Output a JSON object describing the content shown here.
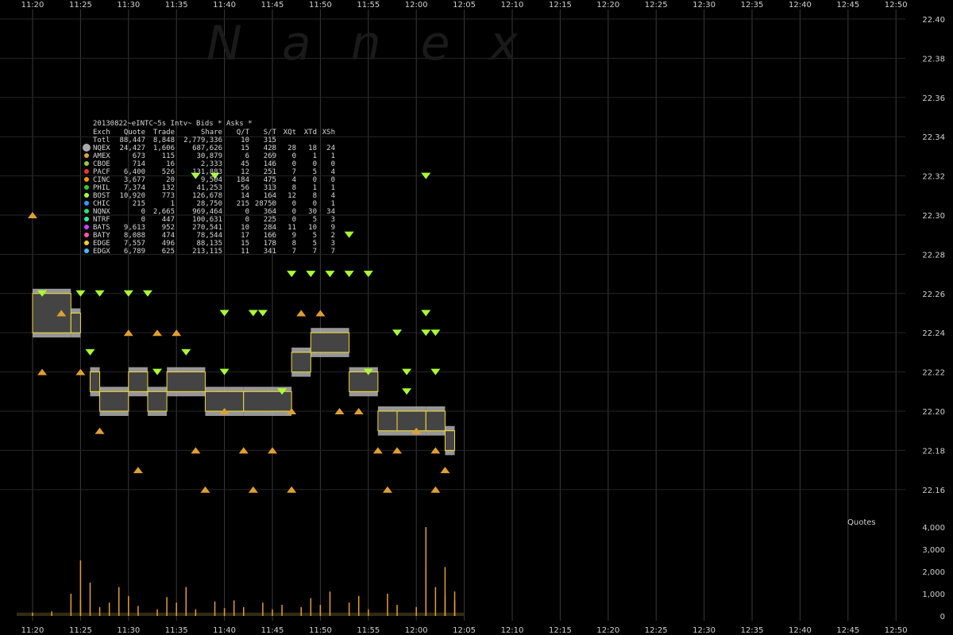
{
  "chart_data": {
    "type": "scatter",
    "watermark": "Nanex",
    "title": "20130822~eINTC~5s Intv~ Bids * Asks *",
    "x_ticks": [
      "11:20",
      "11:25",
      "11:30",
      "11:35",
      "11:40",
      "11:45",
      "11:50",
      "11:55",
      "12:00",
      "12:05",
      "12:10",
      "12:15",
      "12:20",
      "12:25",
      "12:30",
      "12:35",
      "12:40",
      "12:45",
      "12:50"
    ],
    "y_ticks": [
      "22.40",
      "22.38",
      "22.36",
      "22.34",
      "22.32",
      "22.30",
      "22.28",
      "22.26",
      "22.24",
      "22.22",
      "22.20",
      "22.18",
      "22.16"
    ],
    "y_range": [
      22.15,
      22.41
    ],
    "volume_label": "Quotes",
    "volume_ticks": [
      "4,000",
      "3,000",
      "2,000",
      "1,000",
      "0"
    ],
    "volume_range": [
      0,
      4000
    ],
    "legend_header": [
      "Exch",
      "Quote",
      "Trade",
      "Share",
      "Q/T",
      "S/T",
      "XQt",
      "XTd",
      "XSh"
    ],
    "legend_total": [
      "Totl",
      "88,447",
      "8,848",
      "2,779,336",
      "10",
      "315",
      "",
      "",
      ""
    ],
    "legend_rows": [
      {
        "color": "#aaaaaa",
        "cells": [
          "NQEX",
          "24,427",
          "1,606",
          "687,626",
          "15",
          "428",
          "28",
          "18",
          "24"
        ]
      },
      {
        "color": "#e0a030",
        "cells": [
          "AMEX",
          "673",
          "115",
          "30,879",
          "6",
          "269",
          "0",
          "1",
          "1"
        ]
      },
      {
        "color": "#99cc33",
        "cells": [
          "CBOE",
          "714",
          "16",
          "2,333",
          "45",
          "146",
          "0",
          "0",
          "0"
        ]
      },
      {
        "color": "#ff3333",
        "cells": [
          "PACF",
          "6,400",
          "526",
          "131,883",
          "12",
          "251",
          "7",
          "5",
          "4"
        ]
      },
      {
        "color": "#ff9900",
        "cells": [
          "CINC",
          "3,677",
          "20",
          "9,504",
          "184",
          "475",
          "4",
          "0",
          "0"
        ]
      },
      {
        "color": "#33cc33",
        "cells": [
          "PHIL",
          "7,374",
          "132",
          "41,253",
          "56",
          "313",
          "8",
          "1",
          "1"
        ]
      },
      {
        "color": "#aaff33",
        "cells": [
          "BOST",
          "10,920",
          "773",
          "126,678",
          "14",
          "164",
          "12",
          "8",
          "4"
        ]
      },
      {
        "color": "#3399ff",
        "cells": [
          "CHIC",
          "215",
          "1",
          "28,750",
          "215",
          "28750",
          "0",
          "0",
          "1"
        ]
      },
      {
        "color": "#33dd66",
        "cells": [
          "NQNX",
          "0",
          "2,665",
          "969,464",
          "0",
          "364",
          "0",
          "30",
          "34"
        ]
      },
      {
        "color": "#33ee99",
        "cells": [
          "NTRF",
          "0",
          "447",
          "100,631",
          "0",
          "225",
          "0",
          "5",
          "3"
        ]
      },
      {
        "color": "#cc44ff",
        "cells": [
          "BATS",
          "9,613",
          "952",
          "270,541",
          "10",
          "284",
          "11",
          "10",
          "9"
        ]
      },
      {
        "color": "#ff55aa",
        "cells": [
          "BATY",
          "8,088",
          "474",
          "78,544",
          "17",
          "166",
          "9",
          "5",
          "2"
        ]
      },
      {
        "color": "#ffcc33",
        "cells": [
          "EDGE",
          "7,557",
          "496",
          "88,135",
          "15",
          "178",
          "8",
          "5",
          "3"
        ]
      },
      {
        "color": "#44bbff",
        "cells": [
          "EDGX",
          "6,789",
          "625",
          "213,115",
          "11",
          "341",
          "7",
          "7",
          "7"
        ]
      }
    ],
    "nbbo_boxes": [
      {
        "t0": "11:20",
        "t1": "11:24",
        "bid": 22.24,
        "ask": 22.26
      },
      {
        "t0": "11:24",
        "t1": "11:25",
        "bid": 22.24,
        "ask": 22.25
      },
      {
        "t0": "11:26",
        "t1": "11:27",
        "bid": 22.21,
        "ask": 22.22
      },
      {
        "t0": "11:27",
        "t1": "11:30",
        "bid": 22.2,
        "ask": 22.21
      },
      {
        "t0": "11:30",
        "t1": "11:32",
        "bid": 22.21,
        "ask": 22.22
      },
      {
        "t0": "11:32",
        "t1": "11:34",
        "bid": 22.2,
        "ask": 22.21
      },
      {
        "t0": "11:34",
        "t1": "11:38",
        "bid": 22.21,
        "ask": 22.22
      },
      {
        "t0": "11:38",
        "t1": "11:42",
        "bid": 22.2,
        "ask": 22.21
      },
      {
        "t0": "11:42",
        "t1": "11:47",
        "bid": 22.2,
        "ask": 22.21
      },
      {
        "t0": "11:47",
        "t1": "11:49",
        "bid": 22.22,
        "ask": 22.23
      },
      {
        "t0": "11:49",
        "t1": "11:53",
        "bid": 22.23,
        "ask": 22.24
      },
      {
        "t0": "11:53",
        "t1": "11:56",
        "bid": 22.21,
        "ask": 22.22
      },
      {
        "t0": "11:56",
        "t1": "11:58",
        "bid": 22.19,
        "ask": 22.2
      },
      {
        "t0": "11:58",
        "t1": "12:01",
        "bid": 22.19,
        "ask": 22.2
      },
      {
        "t0": "12:01",
        "t1": "12:03",
        "bid": 22.19,
        "ask": 22.2
      },
      {
        "t0": "12:03",
        "t1": "12:04",
        "bid": 22.18,
        "ask": 22.19
      }
    ],
    "bid_quotes": [
      {
        "t": "11:20",
        "p": 22.3
      },
      {
        "t": "11:23",
        "p": 22.25
      },
      {
        "t": "11:25",
        "p": 22.22
      },
      {
        "t": "11:27",
        "p": 22.19
      },
      {
        "t": "11:30",
        "p": 22.24
      },
      {
        "t": "11:31",
        "p": 22.17
      },
      {
        "t": "11:33",
        "p": 22.24
      },
      {
        "t": "11:35",
        "p": 22.24
      },
      {
        "t": "11:37",
        "p": 22.18
      },
      {
        "t": "11:40",
        "p": 22.2
      },
      {
        "t": "11:42",
        "p": 22.18
      },
      {
        "t": "11:45",
        "p": 22.18
      },
      {
        "t": "11:47",
        "p": 22.2
      },
      {
        "t": "11:48",
        "p": 22.25
      },
      {
        "t": "11:50",
        "p": 22.25
      },
      {
        "t": "11:52",
        "p": 22.2
      },
      {
        "t": "11:54",
        "p": 22.2
      },
      {
        "t": "11:56",
        "p": 22.18
      },
      {
        "t": "11:58",
        "p": 22.18
      },
      {
        "t": "12:00",
        "p": 22.19
      },
      {
        "t": "12:02",
        "p": 22.18
      },
      {
        "t": "12:03",
        "p": 22.17
      },
      {
        "t": "11:21",
        "p": 22.22
      },
      {
        "t": "11:38",
        "p": 22.16
      },
      {
        "t": "11:43",
        "p": 22.16
      },
      {
        "t": "11:47",
        "p": 22.16
      },
      {
        "t": "11:57",
        "p": 22.16
      },
      {
        "t": "12:02",
        "p": 22.16
      }
    ],
    "ask_quotes": [
      {
        "t": "11:21",
        "p": 22.26
      },
      {
        "t": "11:25",
        "p": 22.26
      },
      {
        "t": "11:27",
        "p": 22.26
      },
      {
        "t": "11:30",
        "p": 22.26
      },
      {
        "t": "11:32",
        "p": 22.26
      },
      {
        "t": "11:37",
        "p": 22.32
      },
      {
        "t": "11:39",
        "p": 22.32
      },
      {
        "t": "11:40",
        "p": 22.25
      },
      {
        "t": "11:43",
        "p": 22.25
      },
      {
        "t": "11:44",
        "p": 22.25
      },
      {
        "t": "11:47",
        "p": 22.27
      },
      {
        "t": "11:49",
        "p": 22.27
      },
      {
        "t": "11:51",
        "p": 22.27
      },
      {
        "t": "11:53",
        "p": 22.27
      },
      {
        "t": "11:55",
        "p": 22.27
      },
      {
        "t": "11:53",
        "p": 22.29
      },
      {
        "t": "12:01",
        "p": 22.32
      },
      {
        "t": "11:58",
        "p": 22.24
      },
      {
        "t": "12:01",
        "p": 22.24
      },
      {
        "t": "12:01",
        "p": 22.25
      },
      {
        "t": "12:02",
        "p": 22.24
      },
      {
        "t": "11:59",
        "p": 22.22
      },
      {
        "t": "12:02",
        "p": 22.22
      },
      {
        "t": "11:26",
        "p": 22.23
      },
      {
        "t": "11:33",
        "p": 22.22
      },
      {
        "t": "11:36",
        "p": 22.23
      },
      {
        "t": "11:40",
        "p": 22.22
      },
      {
        "t": "11:46",
        "p": 22.21
      },
      {
        "t": "11:55",
        "p": 22.22
      },
      {
        "t": "11:59",
        "p": 22.21
      }
    ],
    "volume_bars": [
      {
        "t": "11:20",
        "v": 150
      },
      {
        "t": "11:22",
        "v": 200
      },
      {
        "t": "11:24",
        "v": 1000
      },
      {
        "t": "11:25",
        "v": 700
      },
      {
        "t": "11:25",
        "v": 2500
      },
      {
        "t": "11:26",
        "v": 1500
      },
      {
        "t": "11:27",
        "v": 400
      },
      {
        "t": "11:28",
        "v": 600
      },
      {
        "t": "11:29",
        "v": 1300
      },
      {
        "t": "11:30",
        "v": 900
      },
      {
        "t": "11:31",
        "v": 450
      },
      {
        "t": "11:33",
        "v": 300
      },
      {
        "t": "11:34",
        "v": 850
      },
      {
        "t": "11:35",
        "v": 600
      },
      {
        "t": "11:36",
        "v": 1300
      },
      {
        "t": "11:37",
        "v": 300
      },
      {
        "t": "11:39",
        "v": 650
      },
      {
        "t": "11:40",
        "v": 350
      },
      {
        "t": "11:41",
        "v": 700
      },
      {
        "t": "11:42",
        "v": 400
      },
      {
        "t": "11:44",
        "v": 600
      },
      {
        "t": "11:45",
        "v": 300
      },
      {
        "t": "11:46",
        "v": 500
      },
      {
        "t": "11:48",
        "v": 400
      },
      {
        "t": "11:49",
        "v": 800
      },
      {
        "t": "11:50",
        "v": 500
      },
      {
        "t": "11:51",
        "v": 1100
      },
      {
        "t": "11:53",
        "v": 600
      },
      {
        "t": "11:54",
        "v": 900
      },
      {
        "t": "11:55",
        "v": 300
      },
      {
        "t": "11:57",
        "v": 1000
      },
      {
        "t": "11:58",
        "v": 500
      },
      {
        "t": "12:00",
        "v": 400
      },
      {
        "t": "12:01",
        "v": 4000
      },
      {
        "t": "12:01",
        "v": 2200
      },
      {
        "t": "12:02",
        "v": 1300
      },
      {
        "t": "12:03",
        "v": 2200
      },
      {
        "t": "12:03",
        "v": 900
      },
      {
        "t": "12:04",
        "v": 1100
      },
      {
        "t": "12:04",
        "v": 700
      }
    ],
    "grid": true,
    "legend_position": "top-left"
  }
}
